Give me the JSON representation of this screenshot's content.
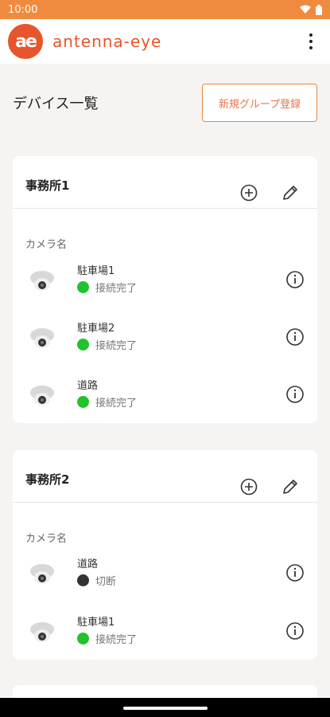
{
  "status_bar": {
    "time": "10:00"
  },
  "app_bar": {
    "logo_text": "ae",
    "brand": "antenna-eye"
  },
  "page": {
    "title": "デバイス一覧",
    "new_group_button": "新規グループ登録"
  },
  "groups": [
    {
      "name": "事務所1",
      "column_label": "カメラ名",
      "cameras": [
        {
          "name": "駐車場1",
          "status": "接続完了",
          "state": "connected"
        },
        {
          "name": "駐車場2",
          "status": "接続完了",
          "state": "connected"
        },
        {
          "name": "道路",
          "status": "接続完了",
          "state": "connected"
        }
      ]
    },
    {
      "name": "事務所2",
      "column_label": "カメラ名",
      "cameras": [
        {
          "name": "道路",
          "status": "切断",
          "state": "disconnected"
        },
        {
          "name": "駐車場1",
          "status": "接続完了",
          "state": "connected"
        }
      ]
    }
  ],
  "colors": {
    "status_bar": "#f08a3e",
    "accent": "#e8542c",
    "connected": "#22c22c",
    "disconnected": "#333333"
  },
  "icons": {
    "add": "add-circle-icon",
    "edit": "pencil-icon",
    "info": "info-icon",
    "more": "more-vert-icon"
  }
}
